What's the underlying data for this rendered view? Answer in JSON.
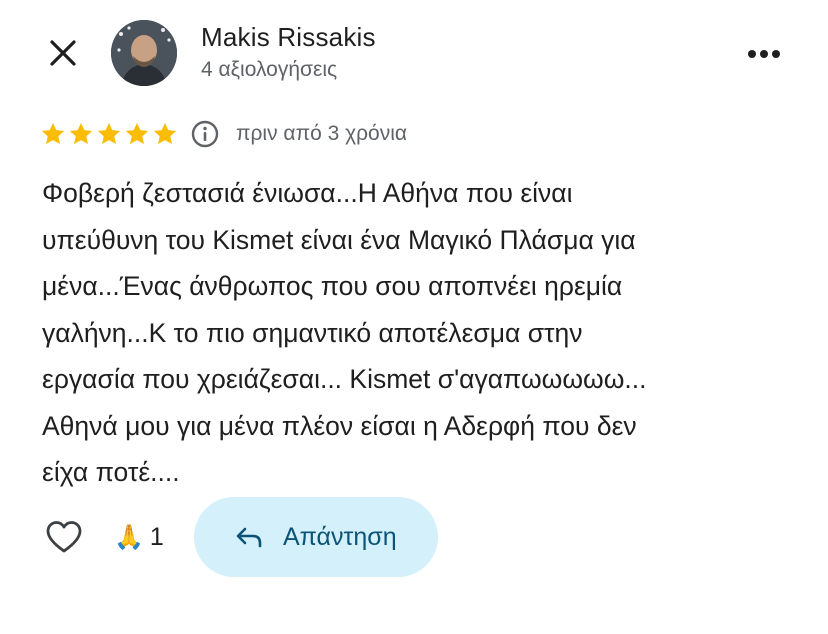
{
  "header": {
    "author_name": "Makis Rissakis",
    "review_count": "4 αξιολογήσεις"
  },
  "rating": {
    "stars": 5,
    "max_stars": 5,
    "date": "πριν από 3 χρόνια"
  },
  "review": {
    "text": "Φοβερή ζεστασιά ένιωσα...Η Αθήνα που είναι\nυπεύθυνη του Kismet είναι ένα Μαγικό Πλάσμα για\nμένα...Ένας άνθρωπος που σου αποπνέει ηρεμία\nγαλήνη...Κ το πιο σημαντικό αποτέλεσμα στην\nεργασία που χρειάζεσαι... Kismet σ'αγαπωωωωω...\nΑθηνά μου για μένα πλέον είσαι η Αδερφή που δεν\nείχα ποτέ...."
  },
  "actions": {
    "reaction_emoji": "🙏",
    "reaction_count": "1",
    "reply_label": "Απάντηση"
  },
  "icons": {
    "close": "close-icon",
    "more": "more-vertical-dots-icon",
    "star": "star-icon",
    "info": "info-icon",
    "like": "heart-outline-icon",
    "reply": "reply-arrow-icon"
  },
  "colors": {
    "star": "#fbbc04",
    "reply_bg": "#d4f0fa",
    "reply_text": "#0b5475",
    "secondary_text": "#5f6368"
  }
}
